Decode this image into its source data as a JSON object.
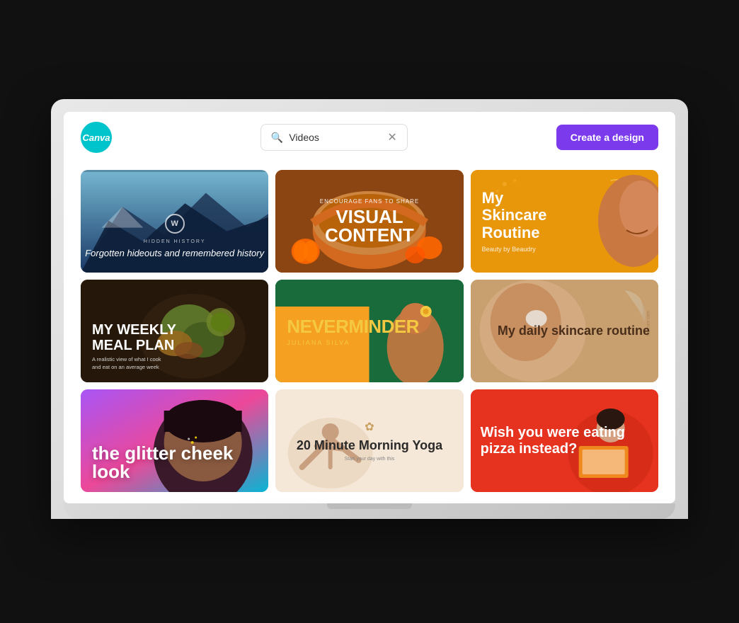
{
  "app": {
    "logo_text": "Canva",
    "logo_color": "#00c4cc"
  },
  "header": {
    "search_placeholder": "Videos",
    "search_value": "Videos",
    "create_button": "Create a design"
  },
  "cards": [
    {
      "id": "mountain",
      "badge": "W",
      "subtitle": "Hidden History",
      "title": "Forgotten hideouts and remembered history",
      "bg_from": "#5b8fa8",
      "bg_to": "#0d1f35"
    },
    {
      "id": "pie",
      "small_text": "Encourage fans to share",
      "big_text": "VISUAL",
      "big_text2": "CONTENT"
    },
    {
      "id": "skincare-routine",
      "title": "My\nSkincare\nRoutine",
      "subtitle": "Beauty by Beaudry",
      "bg": "#e8960a"
    },
    {
      "id": "meal-plan",
      "title": "MY WEEKLY\nMEAL PLAN",
      "subtitle": "A realistic view of what I cook\nand eat on an average week"
    },
    {
      "id": "neverminder",
      "title": "NEVERMINDER",
      "name": "JULIANA SILVA"
    },
    {
      "id": "daily-skincare",
      "title": "My daily\nskincare\nroutine"
    },
    {
      "id": "glitter",
      "title": "the\nglitter\ncheek\nlook"
    },
    {
      "id": "yoga",
      "title": "20 Minute\nMorning Yoga",
      "subtitle": "Start your day with this"
    },
    {
      "id": "pizza",
      "title": "Wish you\nwere eating\npizza instead?"
    }
  ]
}
